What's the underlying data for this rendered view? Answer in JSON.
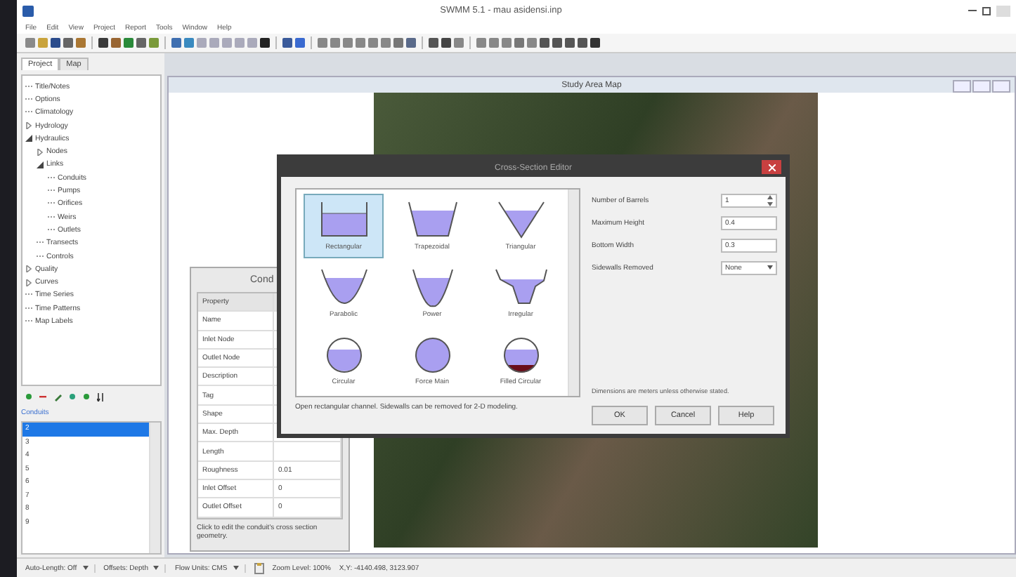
{
  "window": {
    "title": "SWMM 5.1 - mau asidensi.inp"
  },
  "menu": [
    "File",
    "Edit",
    "View",
    "Project",
    "Report",
    "Tools",
    "Window",
    "Help"
  ],
  "browser": {
    "tabs": [
      {
        "label": "Project",
        "selected": true
      },
      {
        "label": "Map",
        "selected": false
      }
    ],
    "tree": [
      {
        "label": "Title/Notes"
      },
      {
        "label": "Options"
      },
      {
        "label": "Climatology"
      },
      {
        "label": "Hydrology",
        "expanded": false
      },
      {
        "label": "Hydraulics",
        "expanded": true,
        "children": [
          {
            "label": "Nodes",
            "expanded": false
          },
          {
            "label": "Links",
            "expanded": true,
            "children": [
              {
                "label": "Conduits"
              },
              {
                "label": "Pumps"
              },
              {
                "label": "Orifices"
              },
              {
                "label": "Weirs"
              },
              {
                "label": "Outlets"
              }
            ]
          },
          {
            "label": "Transects"
          },
          {
            "label": "Controls"
          }
        ]
      },
      {
        "label": "Quality",
        "expanded": false
      },
      {
        "label": "Curves",
        "expanded": false
      },
      {
        "label": "Time Series"
      },
      {
        "label": "Time Patterns"
      },
      {
        "label": "Map Labels"
      }
    ],
    "list_title": "Conduits",
    "items": [
      {
        "label": "2",
        "selected": true
      },
      {
        "label": "3",
        "selected": false
      },
      {
        "label": "4",
        "selected": false
      },
      {
        "label": "5",
        "selected": false
      },
      {
        "label": "6",
        "selected": false
      },
      {
        "label": "7",
        "selected": false
      },
      {
        "label": "8",
        "selected": false
      },
      {
        "label": "9",
        "selected": false
      }
    ]
  },
  "map_window": {
    "title": "Study Area Map"
  },
  "property_editor": {
    "title": "Cond",
    "rows": [
      {
        "name": "Property"
      },
      {
        "name": "Name"
      },
      {
        "name": "Inlet Node"
      },
      {
        "name": "Outlet Node"
      },
      {
        "name": "Description"
      },
      {
        "name": "Tag"
      },
      {
        "name": "Shape"
      },
      {
        "name": "Max. Depth"
      },
      {
        "name": "Length"
      },
      {
        "name": "Roughness",
        "value": "0.01"
      },
      {
        "name": "Inlet Offset",
        "value": "0"
      },
      {
        "name": "Outlet Offset",
        "value": "0"
      }
    ],
    "hint": "Click to edit the conduit's cross section geometry."
  },
  "dialog": {
    "title": "Cross-Section Editor",
    "shapes": [
      {
        "label": "Rectangular",
        "kind": "rectangular",
        "selected": true
      },
      {
        "label": "Trapezoidal",
        "kind": "trapezoidal",
        "selected": false
      },
      {
        "label": "Triangular",
        "kind": "triangular",
        "selected": false
      },
      {
        "label": "Parabolic",
        "kind": "parabolic",
        "selected": false
      },
      {
        "label": "Power",
        "kind": "power",
        "selected": false
      },
      {
        "label": "Irregular",
        "kind": "irregular",
        "selected": false
      },
      {
        "label": "Circular",
        "kind": "circular",
        "selected": false
      },
      {
        "label": "Force Main",
        "kind": "force_main",
        "selected": false
      },
      {
        "label": "Filled Circular",
        "kind": "filled_circular",
        "selected": false
      }
    ],
    "fields": [
      {
        "label": "Number of Barrels",
        "value": "1",
        "kind": "spinner"
      },
      {
        "label": "Maximum Height",
        "value": "0.4",
        "kind": "text"
      },
      {
        "label": "Bottom Width",
        "value": "0.3",
        "kind": "text"
      },
      {
        "label": "Sidewalls Removed",
        "value": "None",
        "kind": "dropdown"
      }
    ],
    "note": "Dimensions are meters unless otherwise stated.",
    "description": "Open rectangular channel. Sidewalls can be removed for 2-D modeling.",
    "buttons": [
      "OK",
      "Cancel",
      "Help"
    ]
  },
  "status_bar": [
    {
      "label": "Auto-Length: Off",
      "kind": "dropdown"
    },
    {
      "label": "Offsets: Depth",
      "kind": "dropdown"
    },
    {
      "label": "Flow Units: CMS",
      "kind": "dropdown"
    },
    {
      "kind": "icon"
    },
    {
      "label": "Zoom Level: 100%",
      "kind": "text"
    },
    {
      "label": "X,Y: -4140.498, 3123.907",
      "kind": "text"
    }
  ]
}
